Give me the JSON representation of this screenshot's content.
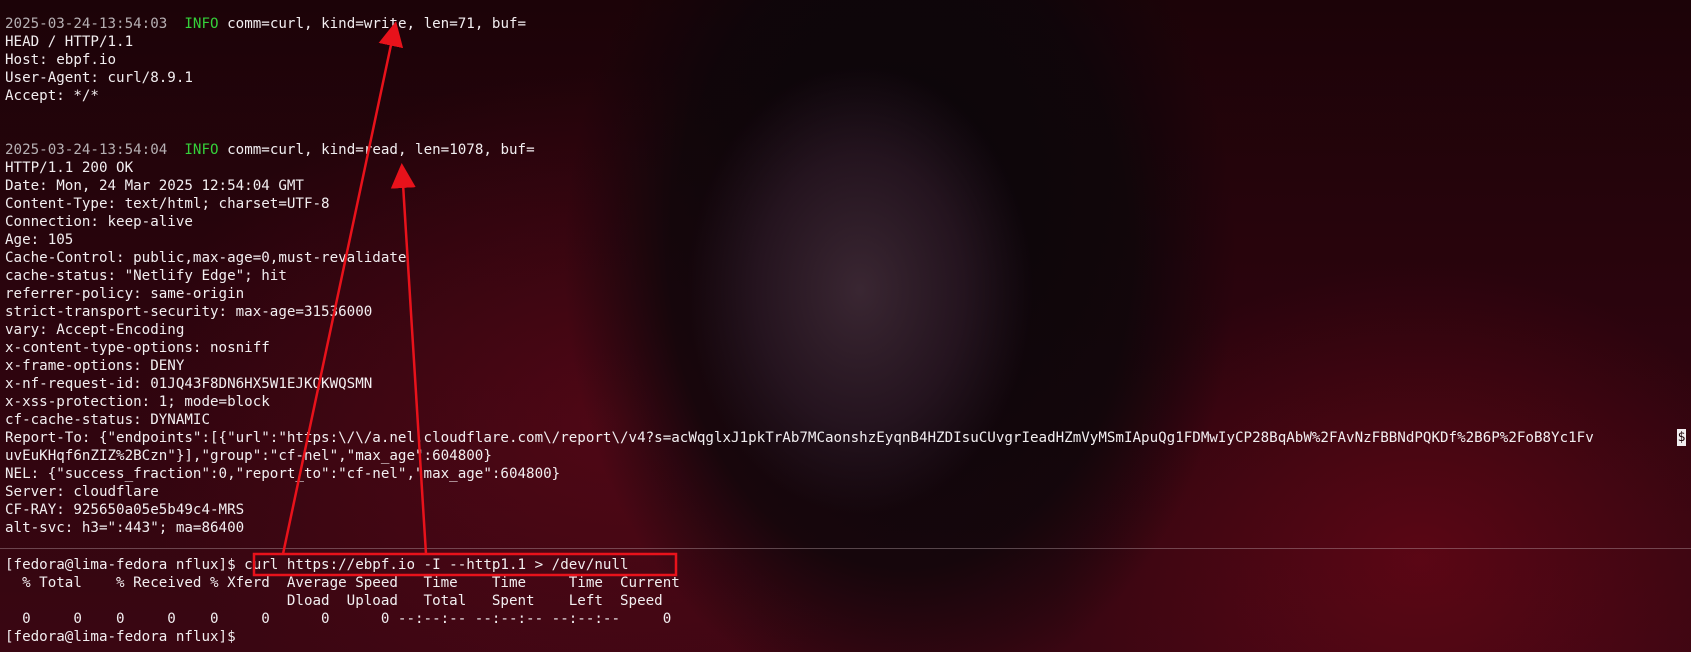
{
  "log_entry_write": {
    "timestamp": "2025-03-24-13:54:03",
    "level": "INFO",
    "message": "comm=curl, kind=write, len=71, buf=",
    "body": [
      "HEAD / HTTP/1.1",
      "Host: ebpf.io",
      "User-Agent: curl/8.9.1",
      "Accept: */*"
    ]
  },
  "log_entry_read": {
    "timestamp": "2025-03-24-13:54:04",
    "level": "INFO",
    "message": "comm=curl, kind=read, len=1078, buf=",
    "body": [
      "HTTP/1.1 200 OK",
      "Date: Mon, 24 Mar 2025 12:54:04 GMT",
      "Content-Type: text/html; charset=UTF-8",
      "Connection: keep-alive",
      "Age: 105",
      "Cache-Control: public,max-age=0,must-revalidate",
      "cache-status: \"Netlify Edge\"; hit",
      "referrer-policy: same-origin",
      "strict-transport-security: max-age=31536000",
      "vary: Accept-Encoding",
      "x-content-type-options: nosniff",
      "x-frame-options: DENY",
      "x-nf-request-id: 01JQ43F8DN6HX5W1EJKQKWQSMN",
      "x-xss-protection: 1; mode=block",
      "cf-cache-status: DYNAMIC",
      "Report-To: {\"endpoints\":[{\"url\":\"https:\\/\\/a.nel.cloudflare.com\\/report\\/v4?s=acWqglxJ1pkTrAb7MCaonshzEyqnB4HZDIsuCUvgrIeadHZmVyMSmIApuQg1FDMwIyCP28BqAbW%2FAvNzFBBNdPQKDf%2B6P%2FoB8Yc1Fv",
      "uvEuKHqf6nZIZ%2BCzn\"}],\"group\":\"cf-nel\",\"max_age\":604800}",
      "NEL: {\"success_fraction\":0,\"report_to\":\"cf-nel\",\"max_age\":604800}",
      "Server: cloudflare",
      "CF-RAY: 925650a05e5b49c4-MRS",
      "alt-svc: h3=\":443\"; ma=86400"
    ],
    "wrap_glyph": "$"
  },
  "shell": {
    "prompt": "[fedora@lima-fedora nflux]$",
    "command": "curl https://ebpf.io -I --http1.1 > /dev/null",
    "progress_header_1": "  % Total    % Received % Xferd  Average Speed   Time    Time     Time  Current",
    "progress_header_2": "                                 Dload  Upload   Total   Spent    Left  Speed",
    "progress_values": "  0     0    0     0    0     0      0      0 --:--:-- --:--:-- --:--:--     0",
    "final_prompt": "[fedora@lima-fedora nflux]$"
  },
  "colors": {
    "level": "#35d13a",
    "timestamp": "#b6b0b3",
    "text": "#f2eef0",
    "annotation": "#e8121b"
  }
}
